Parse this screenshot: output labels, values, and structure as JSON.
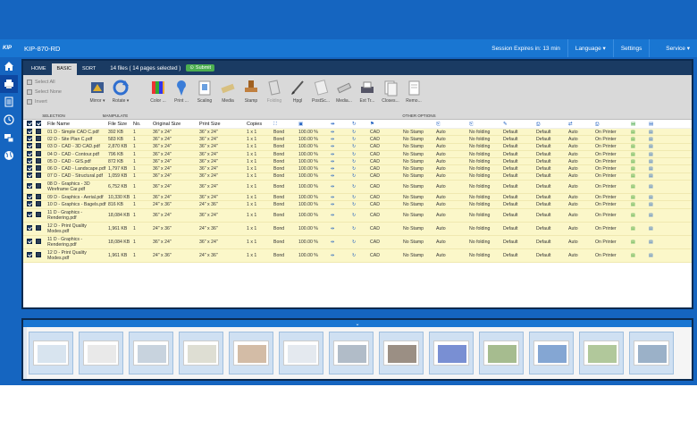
{
  "app": {
    "title": "KIP-870-RD",
    "logo": "KIP",
    "session": "Session Expires in: 13 min",
    "language": "Language",
    "settings": "Settings",
    "user": "Service"
  },
  "tabs": [
    {
      "label": "HOME"
    },
    {
      "label": "BASIC"
    },
    {
      "label": "SORT"
    }
  ],
  "fileinfo": "14 files ( 14 pages selected )",
  "submit": "Submit",
  "selection": {
    "items": [
      "Select All",
      "Select None",
      "Invert"
    ],
    "label": "SELECTION"
  },
  "manipulate": {
    "buttons": [
      {
        "label": "Mirror",
        "icon": "mirror-icon"
      },
      {
        "label": "Rotate",
        "icon": "rotate-icon"
      }
    ],
    "label": "MANIPULATE"
  },
  "other": {
    "buttons": [
      {
        "label": "Color ...",
        "icon": "color-icon"
      },
      {
        "label": "Print ...",
        "icon": "print-quality-icon"
      },
      {
        "label": "Scaling",
        "icon": "scaling-icon"
      },
      {
        "label": "Media",
        "icon": "media-icon"
      },
      {
        "label": "Stamp",
        "icon": "stamp-icon"
      },
      {
        "label": "Folding",
        "icon": "folding-icon"
      },
      {
        "label": "Hpgl",
        "icon": "hpgl-icon"
      },
      {
        "label": "PostSc...",
        "icon": "postscript-icon"
      },
      {
        "label": "Media...",
        "icon": "media-settings-icon"
      },
      {
        "label": "Ext Tr...",
        "icon": "ext-tray-icon"
      },
      {
        "label": "Closes...",
        "icon": "closest-icon"
      },
      {
        "label": "Remo...",
        "icon": "remove-icon"
      }
    ],
    "label": "OTHER OPTIONS"
  },
  "columns": {
    "filename": "File Name",
    "filesize": "File Size",
    "no": "No.",
    "original": "Original Size",
    "print": "Print Size",
    "copies": "Copies"
  },
  "rows": [
    {
      "name": "01 D - Simple CAD C.pdf",
      "size": "392 KB",
      "no": "1",
      "orig": "36\" x 24\"",
      "print": "36\" x 24\"",
      "copies": "1 x 1",
      "media": "Bond",
      "scale": "100.00 %",
      "type": "CAD",
      "stamp": "No Stamp",
      "auto": "Auto",
      "fold": "No folding",
      "d1": "Default",
      "d2": "Default",
      "auto2": "Auto",
      "printer": "On Printer"
    },
    {
      "name": "02 D - Site Plan C.pdf",
      "size": "583 KB",
      "no": "1",
      "orig": "36\" x 24\"",
      "print": "36\" x 24\"",
      "copies": "1 x 1",
      "media": "Bond",
      "scale": "100.00 %",
      "type": "CAD",
      "stamp": "No Stamp",
      "auto": "Auto",
      "fold": "No folding",
      "d1": "Default",
      "d2": "Default",
      "auto2": "Auto",
      "printer": "On Printer"
    },
    {
      "name": "03 D - CAD - 3D CAD.pdf",
      "size": "2,870 KB",
      "no": "1",
      "orig": "36\" x 24\"",
      "print": "36\" x 24\"",
      "copies": "1 x 1",
      "media": "Bond",
      "scale": "100.00 %",
      "type": "CAD",
      "stamp": "No Stamp",
      "auto": "Auto",
      "fold": "No folding",
      "d1": "Default",
      "d2": "Default",
      "auto2": "Auto",
      "printer": "On Printer"
    },
    {
      "name": "04 D - CAD - Contour.pdf",
      "size": "796 KB",
      "no": "1",
      "orig": "36\" x 24\"",
      "print": "36\" x 24\"",
      "copies": "1 x 1",
      "media": "Bond",
      "scale": "100.00 %",
      "type": "CAD",
      "stamp": "No Stamp",
      "auto": "Auto",
      "fold": "No folding",
      "d1": "Default",
      "d2": "Default",
      "auto2": "Auto",
      "printer": "On Printer"
    },
    {
      "name": "05 D - CAD - GIS.pdf",
      "size": "872 KB",
      "no": "1",
      "orig": "36\" x 24\"",
      "print": "36\" x 24\"",
      "copies": "1 x 1",
      "media": "Bond",
      "scale": "100.00 %",
      "type": "CAD",
      "stamp": "No Stamp",
      "auto": "Auto",
      "fold": "No folding",
      "d1": "Default",
      "d2": "Default",
      "auto2": "Auto",
      "printer": "On Printer"
    },
    {
      "name": "06 D - CAD - Landscape.pdf",
      "size": "1,797 KB",
      "no": "1",
      "orig": "36\" x 24\"",
      "print": "36\" x 24\"",
      "copies": "1 x 1",
      "media": "Bond",
      "scale": "100.00 %",
      "type": "CAD",
      "stamp": "No Stamp",
      "auto": "Auto",
      "fold": "No folding",
      "d1": "Default",
      "d2": "Default",
      "auto2": "Auto",
      "printer": "On Printer"
    },
    {
      "name": "07 D - CAD - Structural.pdf",
      "size": "1,059 KB",
      "no": "1",
      "orig": "36\" x 24\"",
      "print": "36\" x 24\"",
      "copies": "1 x 1",
      "media": "Bond",
      "scale": "100.00 %",
      "type": "CAD",
      "stamp": "No Stamp",
      "auto": "Auto",
      "fold": "No folding",
      "d1": "Default",
      "d2": "Default",
      "auto2": "Auto",
      "printer": "On Printer"
    },
    {
      "name": "08 D - Graphics - 3D Wireframe Car.pdf",
      "size": "6,752 KB",
      "no": "1",
      "orig": "36\" x 24\"",
      "print": "36\" x 24\"",
      "copies": "1 x 1",
      "media": "Bond",
      "scale": "100.00 %",
      "type": "CAD",
      "stamp": "No Stamp",
      "auto": "Auto",
      "fold": "No folding",
      "d1": "Default",
      "d2": "Default",
      "auto2": "Auto",
      "printer": "On Printer",
      "tall": true
    },
    {
      "name": "09 D - Graphics - Aerial.pdf",
      "size": "10,330 KB",
      "no": "1",
      "orig": "36\" x 24\"",
      "print": "36\" x 24\"",
      "copies": "1 x 1",
      "media": "Bond",
      "scale": "100.00 %",
      "type": "CAD",
      "stamp": "No Stamp",
      "auto": "Auto",
      "fold": "No folding",
      "d1": "Default",
      "d2": "Default",
      "auto2": "Auto",
      "printer": "On Printer"
    },
    {
      "name": "10 D - Graphics - Bagels.pdf",
      "size": "816 KB",
      "no": "1",
      "orig": "24\" x 36\"",
      "print": "24\" x 36\"",
      "copies": "1 x 1",
      "media": "Bond",
      "scale": "100.00 %",
      "type": "CAD",
      "stamp": "No Stamp",
      "auto": "Auto",
      "fold": "No folding",
      "d1": "Default",
      "d2": "Default",
      "auto2": "Auto",
      "printer": "On Printer"
    },
    {
      "name": "11 D - Graphics - Rendering.pdf",
      "size": "18,084 KB",
      "no": "1",
      "orig": "36\" x 24\"",
      "print": "36\" x 24\"",
      "copies": "1 x 1",
      "media": "Bond",
      "scale": "100.00 %",
      "type": "CAD",
      "stamp": "No Stamp",
      "auto": "Auto",
      "fold": "No folding",
      "d1": "Default",
      "d2": "Default",
      "auto2": "Auto",
      "printer": "On Printer",
      "tall": true
    },
    {
      "name": "12 D - Print Quality Modes.pdf",
      "size": "1,961 KB",
      "no": "1",
      "orig": "24\" x 36\"",
      "print": "24\" x 36\"",
      "copies": "1 x 1",
      "media": "Bond",
      "scale": "100.00 %",
      "type": "CAD",
      "stamp": "No Stamp",
      "auto": "Auto",
      "fold": "No folding",
      "d1": "Default",
      "d2": "Default",
      "auto2": "Auto",
      "printer": "On Printer",
      "tall": true
    },
    {
      "name": "11 D - Graphics - Rendering.pdf",
      "size": "18,084 KB",
      "no": "1",
      "orig": "36\" x 24\"",
      "print": "36\" x 24\"",
      "copies": "1 x 1",
      "media": "Bond",
      "scale": "100.00 %",
      "type": "CAD",
      "stamp": "No Stamp",
      "auto": "Auto",
      "fold": "No folding",
      "d1": "Default",
      "d2": "Default",
      "auto2": "Auto",
      "printer": "On Printer",
      "tall": true
    },
    {
      "name": "12 D - Print Quality Modes.pdf",
      "size": "1,961 KB",
      "no": "1",
      "orig": "24\" x 36\"",
      "print": "24\" x 36\"",
      "copies": "1 x 1",
      "media": "Bond",
      "scale": "100.00 %",
      "type": "CAD",
      "stamp": "No Stamp",
      "auto": "Auto",
      "fold": "No folding",
      "d1": "Default",
      "d2": "Default",
      "auto2": "Auto",
      "printer": "On Printer",
      "tall": true
    }
  ],
  "thumbs": {
    "count": 14,
    "toggle": "⌄"
  },
  "colors": {
    "brand": "#1976d2",
    "dark": "#1a3b63",
    "rowbg": "#fbf7c9",
    "submit": "#4caf50"
  }
}
